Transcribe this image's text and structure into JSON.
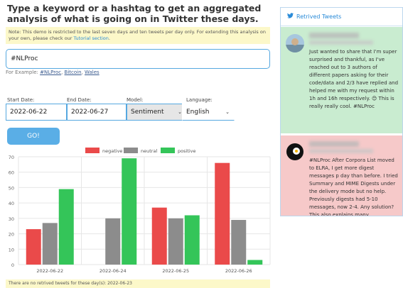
{
  "header": {
    "title": "Type a keyword or a hashtag to get an aggregated analysis of what is going on in Twitter these days."
  },
  "note": {
    "text": "Note: This demo is restricted to the last seven days and ten tweets per day only. For extending this analysis on your own, please check our ",
    "link": "Tutorial section",
    "end": "."
  },
  "search": {
    "value": "#NLProc"
  },
  "example": {
    "prefix": "For Example: ",
    "links": [
      "#NLProc",
      "Bitcoin",
      "Wales"
    ],
    "sep": ", "
  },
  "form": {
    "start_label": "Start Date:",
    "start_value": "2022-06-22",
    "end_label": "End Date:",
    "end_value": "2022-06-27",
    "model_label": "Model:",
    "model_value": "Sentiment",
    "language_label": "Language:",
    "language_value": "English",
    "go_label": "GO!"
  },
  "colors": {
    "negative": "#ea4a4a",
    "neutral": "#8c8c8c",
    "positive": "#34c559",
    "accent": "#2a8bd8"
  },
  "chart_data": {
    "type": "bar",
    "categories": [
      "2022-06-22",
      "2022-06-24",
      "2022-06-25",
      "2022-06-26"
    ],
    "series": [
      {
        "name": "negative",
        "values": [
          23,
          0,
          37,
          66
        ]
      },
      {
        "name": "neutral",
        "values": [
          27,
          30,
          30,
          29
        ]
      },
      {
        "name": "positive",
        "values": [
          49,
          69,
          32,
          3
        ]
      }
    ],
    "ylim": [
      0,
      70
    ],
    "yticks": [
      0,
      10,
      20,
      30,
      40,
      50,
      60,
      70
    ],
    "legend": "top-center",
    "grid": true
  },
  "footnote": "There are no retrived tweets for these day(s): 2022-06-23",
  "panel": {
    "title": "Retrived Tweets",
    "tweets": [
      {
        "sentiment": "positive",
        "text": "Just wanted to share that I'm super surprised and thankful, as I've reached out to 3 authors of different papers asking for their code/data and 2/3 have replied and helped me with my request within 1h and 16h respectively. 😊 This is really really cool. #NLProc"
      },
      {
        "sentiment": "negative",
        "text": "#NLProc After Corpora List moved to ELRA, I get more digest messages p day than before. I tried Summary and MIME Digests under the delivery mode but no help. Previously digests had 5-10 messages, now 2-4. Any solution? This also explains many"
      }
    ]
  }
}
